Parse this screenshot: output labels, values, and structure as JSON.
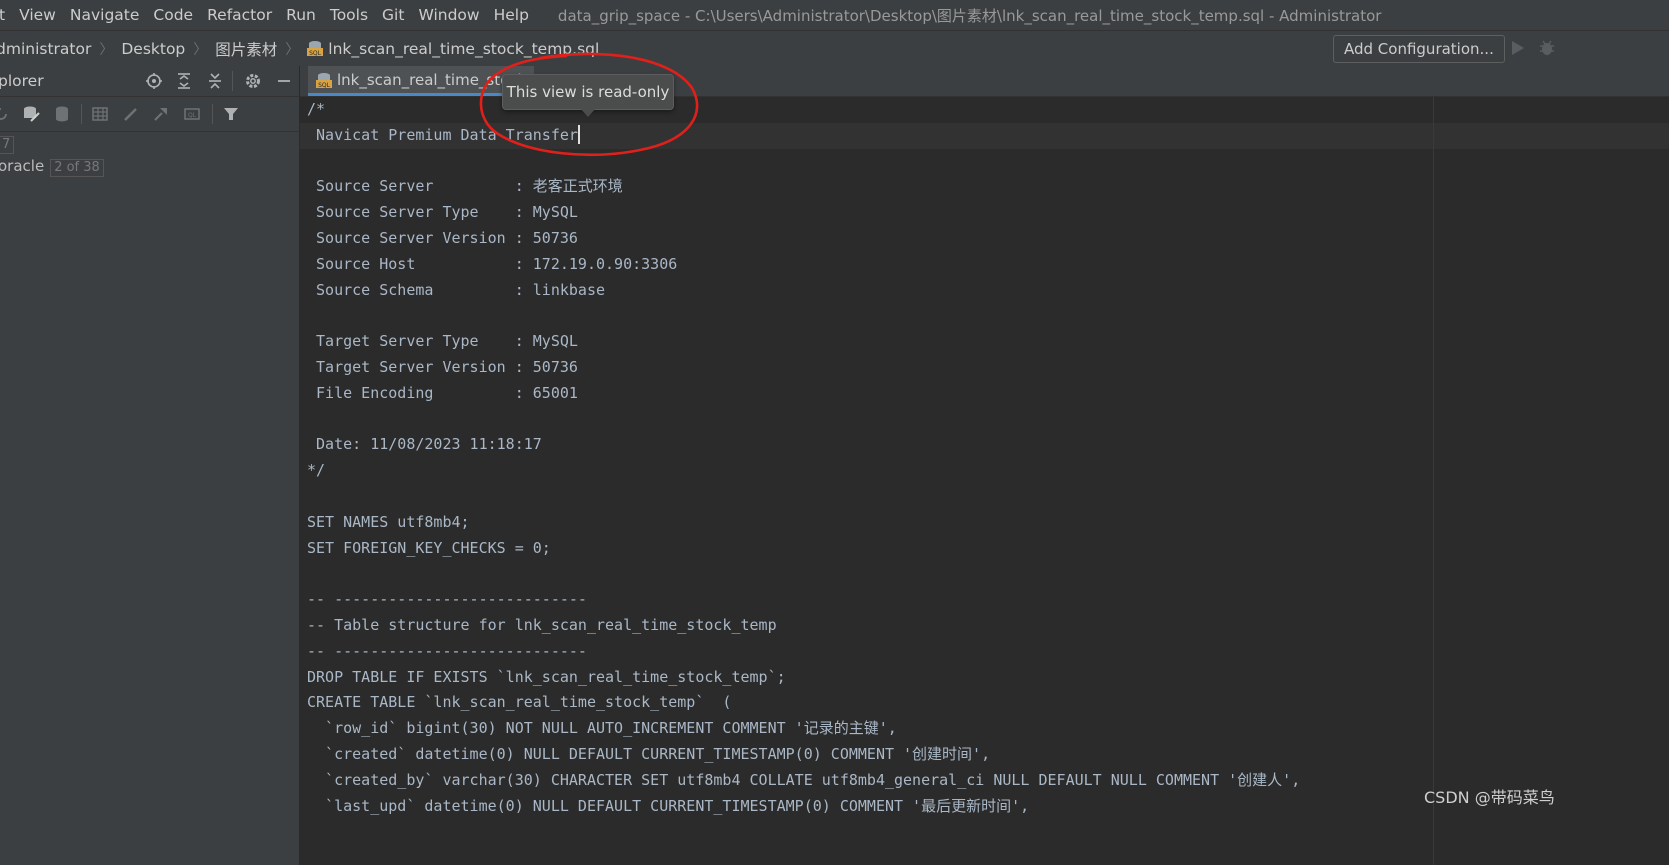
{
  "menu": {
    "items": [
      "t",
      "View",
      "Navigate",
      "Code",
      "Refactor",
      "Run",
      "Tools",
      "Git",
      "Window",
      "Help"
    ],
    "window_title": "data_grip_space - C:\\Users\\Administrator\\Desktop\\图片素材\\lnk_scan_real_time_stock_temp.sql - Administrator"
  },
  "breadcrumb": {
    "items": [
      "dministrator",
      "Desktop",
      "图片素材",
      "lnk_scan_real_time_stock_temp.sql"
    ]
  },
  "toolbar": {
    "add_configuration": "Add Configuration..."
  },
  "explorer": {
    "title": "plorer",
    "row1_label": "7",
    "row2_label": "oracle",
    "row2_badge": "2 of 38"
  },
  "editor": {
    "tab_label": "lnk_scan_real_time_stock",
    "tooltip": "This view is read-only",
    "lines": [
      "/*",
      " Navicat Premium Data Transfer",
      "",
      " Source Server         : 老客正式环境",
      " Source Server Type    : MySQL",
      " Source Server Version : 50736",
      " Source Host           : 172.19.0.90:3306",
      " Source Schema         : linkbase",
      "",
      " Target Server Type    : MySQL",
      " Target Server Version : 50736",
      " File Encoding         : 65001",
      "",
      " Date: 11/08/2023 11:18:17",
      "*/",
      "",
      "SET NAMES utf8mb4;",
      "SET FOREIGN_KEY_CHECKS = 0;",
      "",
      "-- ----------------------------",
      "-- Table structure for lnk_scan_real_time_stock_temp",
      "-- ----------------------------",
      "DROP TABLE IF EXISTS `lnk_scan_real_time_stock_temp`;",
      "CREATE TABLE `lnk_scan_real_time_stock_temp`  (",
      "  `row_id` bigint(30) NOT NULL AUTO_INCREMENT COMMENT '记录的主键',",
      "  `created` datetime(0) NULL DEFAULT CURRENT_TIMESTAMP(0) COMMENT '创建时间',",
      "  `created_by` varchar(30) CHARACTER SET utf8mb4 COLLATE utf8mb4_general_ci NULL DEFAULT NULL COMMENT '创建人',",
      "  `last_upd` datetime(0) NULL DEFAULT CURRENT_TIMESTAMP(0) COMMENT '最后更新时间',"
    ]
  },
  "watermark": "CSDN @带码菜鸟",
  "colors": {
    "chrome_bg": "#3c3f41",
    "editor_bg": "#2b2b2b",
    "code_text": "#a9b7c6",
    "annotation_red": "#e0201a",
    "tab_underline": "#4a88c7"
  }
}
